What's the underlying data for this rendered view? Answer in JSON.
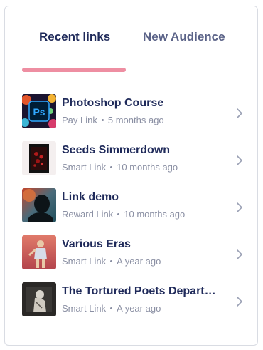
{
  "tabs": {
    "recent_label": "Recent links",
    "audience_label": "New Audience",
    "active": "recent",
    "indicator_color": "#ee8ea2"
  },
  "links": [
    {
      "title": "Photoshop Course",
      "type": "Pay Link",
      "time": "5 months ago",
      "thumb": "photoshop-thumbnail"
    },
    {
      "title": "Seeds Simmerdown",
      "type": "Smart Link",
      "time": "10 months ago",
      "thumb": "album-art-thumbnail"
    },
    {
      "title": "Link demo",
      "type": "Reward Link",
      "time": "10 months ago",
      "thumb": "silhouette-thumbnail"
    },
    {
      "title": "Various Eras",
      "type": "Smart Link",
      "time": "A year ago",
      "thumb": "performer-thumbnail"
    },
    {
      "title": "The Tortured Poets Depart…",
      "type": "Smart Link",
      "time": "A year ago",
      "thumb": "album-cover-thumbnail"
    }
  ],
  "colors": {
    "title": "#1f2a5a",
    "meta": "#8a8fa3",
    "accent": "#ee8ea2"
  }
}
